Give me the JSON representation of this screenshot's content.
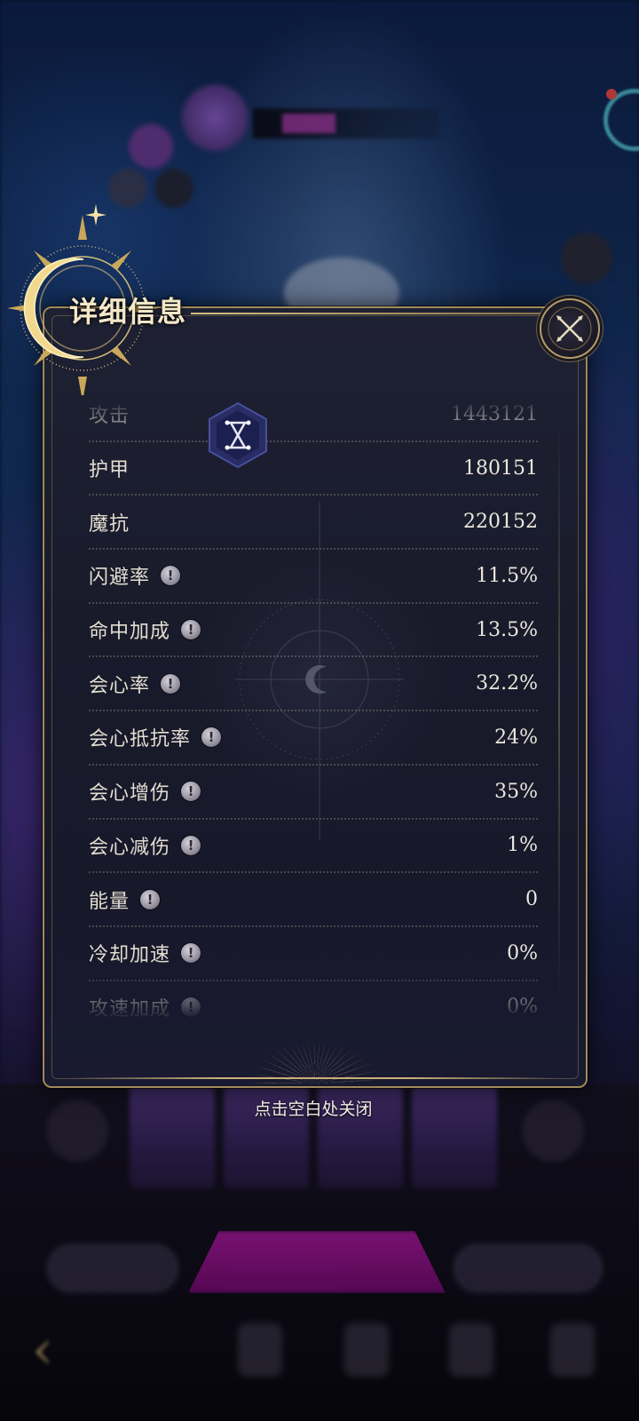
{
  "panel": {
    "title": "详细信息",
    "close_icon": "close-x-icon"
  },
  "stats": [
    {
      "label": "攻击",
      "value": "1443121",
      "has_info": false
    },
    {
      "label": "护甲",
      "value": "180151",
      "has_info": false
    },
    {
      "label": "魔抗",
      "value": "220152",
      "has_info": false
    },
    {
      "label": "闪避率",
      "value": "11.5%",
      "has_info": true
    },
    {
      "label": "命中加成",
      "value": "13.5%",
      "has_info": true
    },
    {
      "label": "会心率",
      "value": "32.2%",
      "has_info": true
    },
    {
      "label": "会心抵抗率",
      "value": "24%",
      "has_info": true
    },
    {
      "label": "会心增伤",
      "value": "35%",
      "has_info": true
    },
    {
      "label": "会心减伤",
      "value": "1%",
      "has_info": true
    },
    {
      "label": "能量",
      "value": "0",
      "has_info": true
    },
    {
      "label": "冷却加速",
      "value": "0%",
      "has_info": true
    },
    {
      "label": "攻速加成",
      "value": "0%",
      "has_info": true
    }
  ],
  "info_icon_glyph": "!",
  "hint": "点击空白处关闭",
  "colors": {
    "gold": "#c9b078",
    "panel_bg": "#1a1c2c",
    "text": "#e3ddd0"
  }
}
